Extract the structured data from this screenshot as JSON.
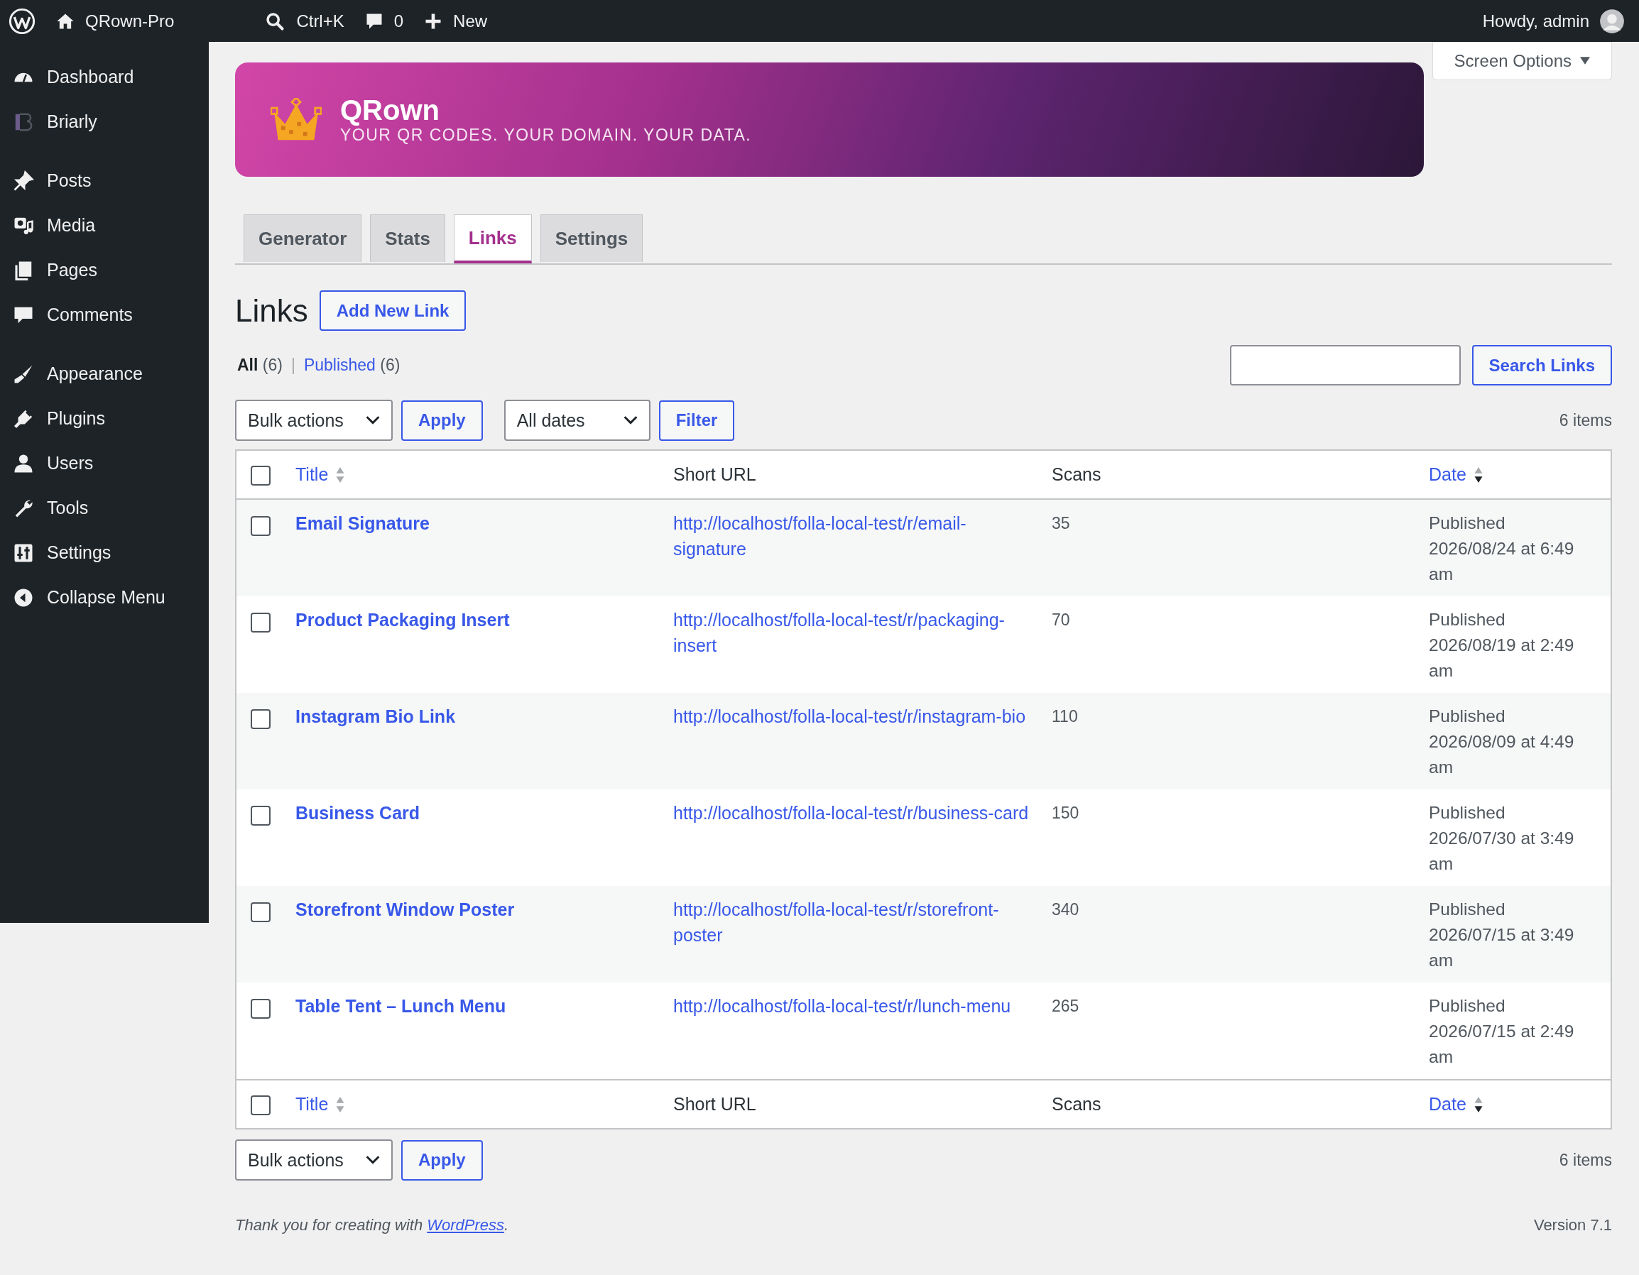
{
  "admin_bar": {
    "site": "QRown-Pro",
    "search_shortcut": "Ctrl+K",
    "comments_count": "0",
    "new_label": "New",
    "greeting": "Howdy, admin"
  },
  "sidebar": {
    "groups": [
      [
        {
          "label": "Dashboard"
        },
        {
          "label": "Briarly"
        }
      ],
      [
        {
          "label": "Posts"
        },
        {
          "label": "Media"
        },
        {
          "label": "Pages"
        },
        {
          "label": "Comments"
        }
      ],
      [
        {
          "label": "Appearance"
        },
        {
          "label": "Plugins"
        },
        {
          "label": "Users"
        },
        {
          "label": "Tools"
        },
        {
          "label": "Settings"
        },
        {
          "label": "Collapse Menu"
        }
      ]
    ]
  },
  "screen_options": "Screen Options",
  "banner": {
    "title": "QRown",
    "tagline": "YOUR QR CODES. YOUR DOMAIN. YOUR DATA."
  },
  "tabs": [
    {
      "label": "Generator",
      "selected": false
    },
    {
      "label": "Stats",
      "selected": false
    },
    {
      "label": "Links",
      "selected": true
    },
    {
      "label": "Settings",
      "selected": false
    }
  ],
  "heading": "Links",
  "add_button": "Add New Link",
  "views": [
    {
      "label": "All",
      "count": "(6)",
      "selected": true
    },
    {
      "label": "Published",
      "count": "(6)",
      "selected": false
    }
  ],
  "views_separator": "|",
  "search_button": "Search Links",
  "top_nav": {
    "bulk": "Bulk actions",
    "apply": "Apply",
    "dates": "All dates",
    "filter": "Filter",
    "count": "6 items"
  },
  "table": {
    "header_checked": false,
    "columns": [
      {
        "label": "Title",
        "sortable": true,
        "sorted_desc": false
      },
      {
        "label": "Short URL",
        "sortable": false
      },
      {
        "label": "Scans",
        "sortable": false
      },
      {
        "label": "Date",
        "sortable": true,
        "sorted_desc": true
      }
    ],
    "footer_checked": false,
    "footer_columns": [
      {
        "label": "Title",
        "sortable": true,
        "sorted_desc": false
      },
      {
        "label": "Short URL",
        "sortable": false
      },
      {
        "label": "Scans",
        "sortable": false
      },
      {
        "label": "Date",
        "sortable": true,
        "sorted_desc": true
      }
    ],
    "rows": [
      {
        "title": "Email Signature",
        "url": "http://localhost/folla-local-test/r/email-signature",
        "scans": "35",
        "status": "Published",
        "date": "2026/08/24 at 6:49 am",
        "checked": false
      },
      {
        "title": "Product Packaging Insert",
        "url": "http://localhost/folla-local-test/r/packaging-insert",
        "scans": "70",
        "status": "Published",
        "date": "2026/08/19 at 2:49 am",
        "checked": false
      },
      {
        "title": "Instagram Bio Link",
        "url": "http://localhost/folla-local-test/r/instagram-bio",
        "scans": "110",
        "status": "Published",
        "date": "2026/08/09 at 4:49 am",
        "checked": false
      },
      {
        "title": "Business Card",
        "url": "http://localhost/folla-local-test/r/business-card",
        "scans": "150",
        "status": "Published",
        "date": "2026/07/30 at 3:49 am",
        "checked": false
      },
      {
        "title": "Storefront Window Poster",
        "url": "http://localhost/folla-local-test/r/storefront-poster",
        "scans": "340",
        "status": "Published",
        "date": "2026/07/15 at 3:49 am",
        "checked": false
      },
      {
        "title": "Table Tent – Lunch Menu",
        "url": "http://localhost/folla-local-test/r/lunch-menu",
        "scans": "265",
        "status": "Published",
        "date": "2026/07/15 at 2:49 am",
        "checked": false
      }
    ]
  },
  "bottom_nav": {
    "bulk": "Bulk actions",
    "apply": "Apply",
    "count": "6 items"
  },
  "footer": {
    "before": "Thank you for creating with",
    "link": "WordPress",
    "after": ".",
    "version": "Version 7.1"
  }
}
